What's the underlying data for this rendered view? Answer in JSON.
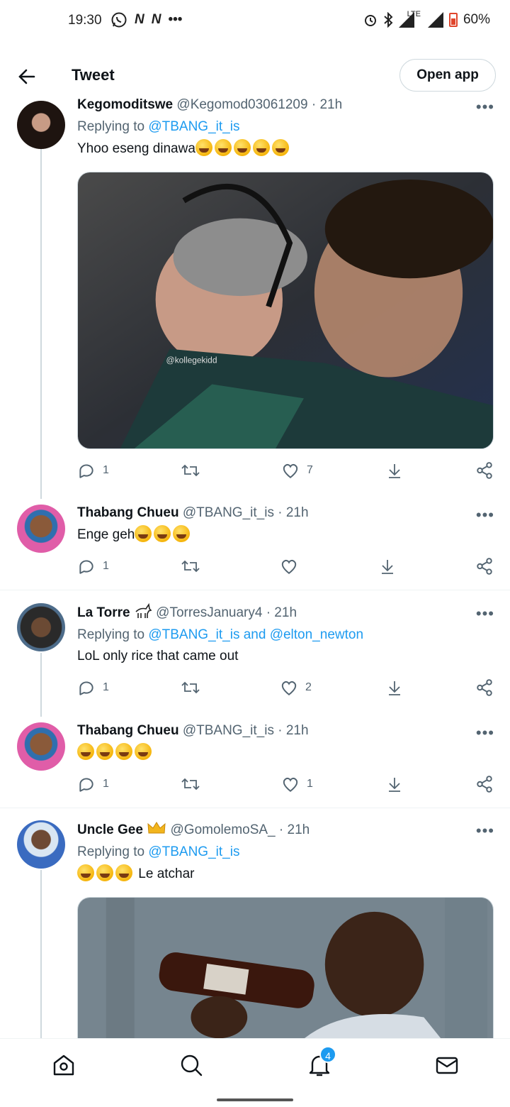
{
  "status_bar": {
    "time": "19:30",
    "left_icons": [
      "whatsapp-icon",
      "N",
      "N",
      "•••"
    ],
    "lte": "LTE",
    "battery": "60%"
  },
  "header": {
    "title": "Tweet",
    "open_app": "Open app"
  },
  "tweets": [
    {
      "name": "Kegomoditswe",
      "handle": "@Kegomod03061209",
      "time": "· 21h",
      "replying_label": "Replying to",
      "replying_to": "@TBANG_it_is",
      "text": "Yhoo eseng dinawa",
      "emoji_count": 5,
      "image_watermark": "@kollegekidd",
      "replies": "1",
      "likes": "7"
    },
    {
      "name": "Thabang Chueu",
      "handle": "@TBANG_it_is",
      "time": "· 21h",
      "text": "Enge geh",
      "emoji_count": 3,
      "replies": "1",
      "likes": ""
    },
    {
      "name": "La Torre",
      "handle": "@TorresJanuary4",
      "time": "· 21h",
      "replying_label": "Replying to",
      "replying_to": "@TBANG_it_is and @elton_newton",
      "text": "LoL only rice that came out",
      "replies": "1",
      "likes": "2"
    },
    {
      "name": "Thabang Chueu",
      "handle": "@TBANG_it_is",
      "time": "· 21h",
      "text": "",
      "emoji_count": 4,
      "replies": "1",
      "likes": "1"
    },
    {
      "name": "Uncle Gee",
      "handle": "@GomolemoSA_",
      "time": "· 21h",
      "replying_label": "Replying to",
      "replying_to": "@TBANG_it_is",
      "text": "Le atchar",
      "emoji_count": 3
    }
  ],
  "more_label": "•••",
  "bottom_nav": {
    "notification_badge": "4"
  },
  "colors": {
    "accent": "#1d9bf0",
    "text": "#0f1419",
    "secondary_text": "#536471"
  }
}
